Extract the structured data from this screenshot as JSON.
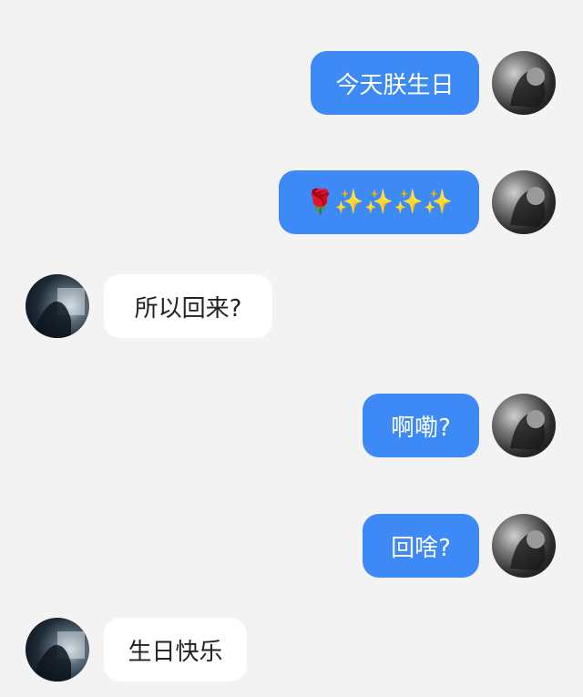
{
  "messages": [
    {
      "side": "sent",
      "text": "今天朕生日"
    },
    {
      "side": "sent",
      "text": "🌹✨✨✨✨"
    },
    {
      "side": "recv",
      "text": "所以回来?"
    },
    {
      "side": "sent",
      "text": "啊嘞?"
    },
    {
      "side": "sent",
      "text": "回啥?"
    },
    {
      "side": "recv",
      "text": "生日快乐"
    }
  ],
  "colors": {
    "sent_bubble": "#3d8af7",
    "recv_bubble": "#ffffff",
    "background": "#f3f3f3"
  }
}
